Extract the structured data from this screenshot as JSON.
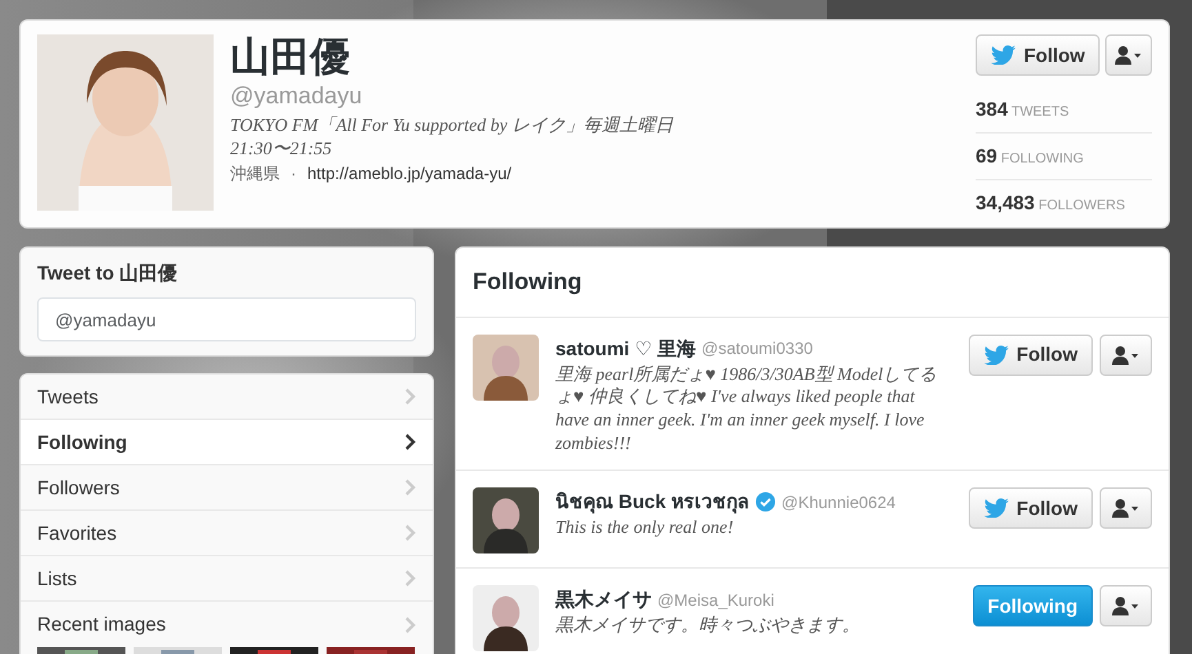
{
  "profile": {
    "name": "山田優",
    "handle": "@yamadayu",
    "bio": "TOKYO FM「All For Yu supported by レイク」毎週土曜日 21:30〜21:55",
    "location": "沖縄県",
    "separator": "·",
    "url": "http://ameblo.jp/yamada-yu/",
    "follow_label": "Follow",
    "following": false,
    "stats": [
      {
        "count": "384",
        "label": "TWEETS"
      },
      {
        "count": "69",
        "label": "FOLLOWING"
      },
      {
        "count": "34,483",
        "label": "FOLLOWERS"
      }
    ]
  },
  "tweet_to": {
    "title": "Tweet to 山田優",
    "placeholder": "@yamadayu"
  },
  "nav": [
    {
      "label": "Tweets",
      "selected": false
    },
    {
      "label": "Following",
      "selected": true
    },
    {
      "label": "Followers",
      "selected": false
    },
    {
      "label": "Favorites",
      "selected": false
    },
    {
      "label": "Lists",
      "selected": false
    },
    {
      "label": "Recent images",
      "selected": false
    }
  ],
  "following_panel": {
    "title": "Following",
    "users": [
      {
        "name": "satoumi ♡ 里海",
        "handle": "@satoumi0330",
        "verified": false,
        "bio": "里海 pearl所属だょ♥ 1986/3/30AB型 Modelしてるょ♥ 仲良くしてね♥ I've always liked people that have an inner geek. I'm an inner geek myself. I love zombies!!!",
        "button": "Follow",
        "following": false
      },
      {
        "name": "นิชคุณ Buck หรเวชกุล",
        "handle": "@Khunnie0624",
        "verified": true,
        "bio": "This is the only real one!",
        "button": "Follow",
        "following": false
      },
      {
        "name": "黒木メイサ",
        "handle": "@Meisa_Kuroki",
        "verified": false,
        "bio": "黒木メイサです。時々つぶやきます。",
        "button": "Following",
        "following": true
      }
    ]
  }
}
